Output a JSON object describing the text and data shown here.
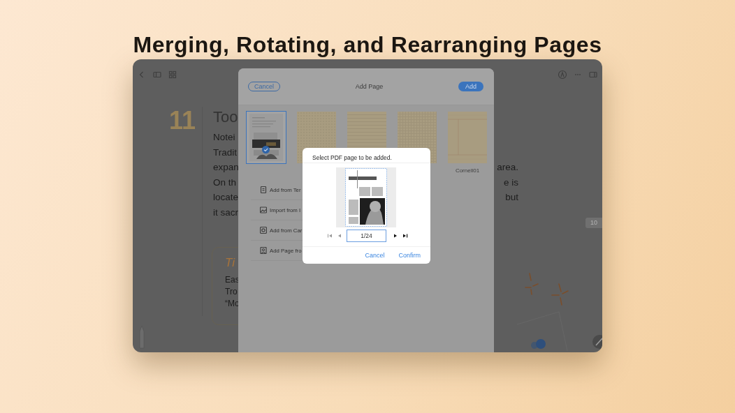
{
  "headline": "Merging, Rotating, and Rearranging Pages",
  "note": {
    "page_number": "11",
    "title": "Too",
    "lines": [
      {
        "start": "Notei"
      },
      {
        "start": "Tradit"
      },
      {
        "start": "expan",
        "end": "area."
      },
      {
        "start": "On th",
        "end": "e is"
      },
      {
        "start": "locate",
        "end": "but"
      },
      {
        "start": "it sacr"
      }
    ],
    "tip": {
      "title": "Ti",
      "lines": [
        "Eas",
        "Tro",
        "“Mo"
      ]
    },
    "page_badge": "10"
  },
  "sheet": {
    "cancel": "Cancel",
    "title": "Add Page",
    "add": "Add",
    "templates": [
      {
        "kind": "picture",
        "selected": true
      },
      {
        "kind": "dotted",
        "selected": false
      },
      {
        "kind": "lined",
        "selected": false
      },
      {
        "kind": "grid",
        "selected": false
      },
      {
        "kind": "cornell",
        "label": "Cornell01",
        "selected": false
      }
    ],
    "options": [
      {
        "label": "Add from Ter"
      },
      {
        "label": "Import from I"
      },
      {
        "label": "Add from Car"
      },
      {
        "label": "Add Page fro"
      }
    ]
  },
  "dialog": {
    "title": "Select PDF page to be added.",
    "preview": {
      "kind": "picture"
    },
    "page_field": {
      "value": "1/24"
    },
    "buttons": [
      {
        "label": "Cancel"
      },
      {
        "label": "Confirm"
      }
    ]
  }
}
